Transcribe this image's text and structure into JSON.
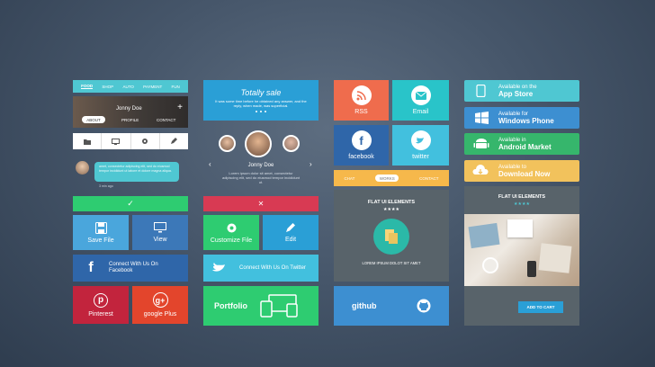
{
  "col1": {
    "nav": [
      "FOOD",
      "SHOP",
      "AUTO",
      "PAYMENT",
      "FUN"
    ],
    "profile": {
      "name": "Jonny Doe",
      "plus": "+",
      "tabs": [
        "ABOUT",
        "PROFILE",
        "CONTACT"
      ]
    },
    "chat": {
      "message": "amet, consectetur adipiscing elit, sed do eiusmod tempor incididunt ut labore et dolore magna aliqua.",
      "time": "3 min ago"
    },
    "check": "✓",
    "save_file": "Save File",
    "view": "View",
    "facebook_connect": "Connect With Us On Facebook",
    "pinterest": "Pinterest",
    "google_plus": "google Plus"
  },
  "col2": {
    "sale": {
      "title": "Totally sale",
      "text": "It was some time before he obtained any answer, and the reply, when made, was superficial."
    },
    "profile": {
      "name": "Jonny Doe",
      "text": "Lorem ipsum dolor sit amet, consectetur adipiscing elit, sed do eiusmod tempor incididunt ut."
    },
    "close": "✕",
    "customize": "Customize File",
    "edit": "Edit",
    "twitter_connect": "Connect With Us On Twitter",
    "portfolio": "Portfolio"
  },
  "col3": {
    "rss": "RSS",
    "email": "Email",
    "facebook": "facebook",
    "twitter": "twitter",
    "tabs": [
      "CHAT",
      "WORKS",
      "CONTACT"
    ],
    "card": {
      "title": "FLAT UI ELEMENTS",
      "stars": "★★★★",
      "text": "LOREM IPSUM DOLOT SIT AMET"
    },
    "github": "github"
  },
  "col4": {
    "stores": [
      {
        "small": "Available on the",
        "big": "App Store",
        "color": "#4fc7d2"
      },
      {
        "small": "Available for",
        "big": "Windows Phone",
        "color": "#3d8fd1"
      },
      {
        "small": "Available in",
        "big": "Android Market",
        "color": "#36b66c"
      },
      {
        "small": "Available to",
        "big": "Download Now",
        "color": "#f2c25c"
      }
    ],
    "card": {
      "title": "FLAT UI ELEMENTS",
      "stars": "★★★★",
      "button": "ADD TO CART"
    }
  }
}
